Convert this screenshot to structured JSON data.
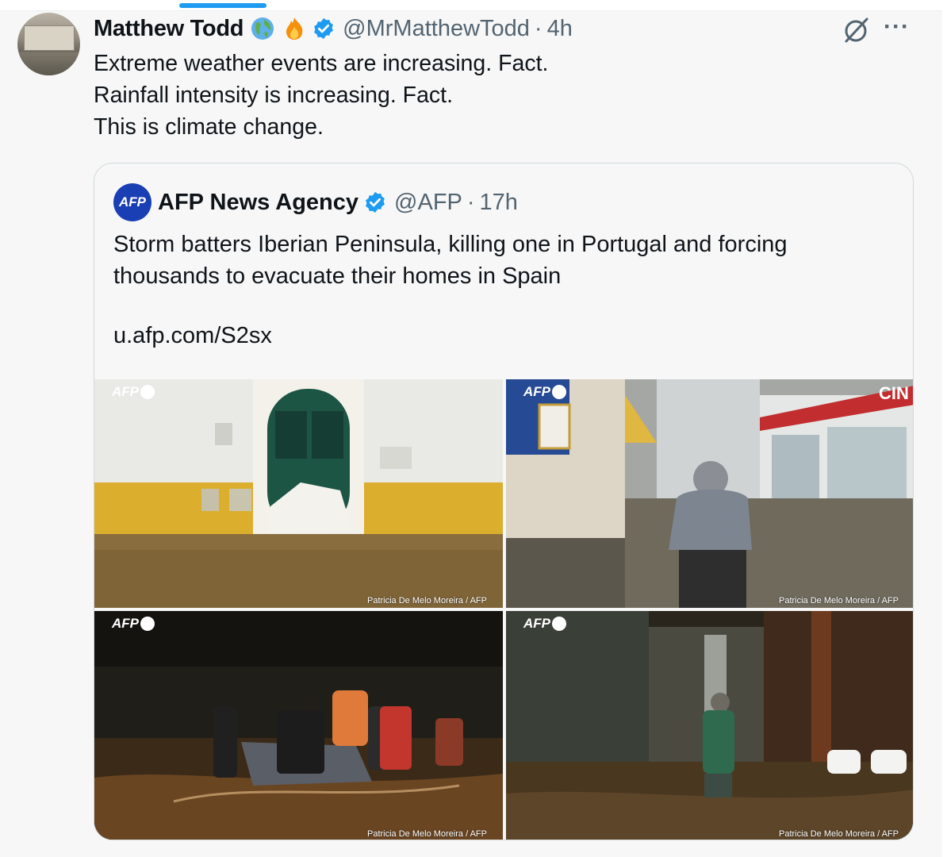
{
  "tweet": {
    "author_name": "Matthew Todd",
    "emojis": [
      "globe-emoji",
      "fire-emoji"
    ],
    "verified_icon": "verified-badge-icon",
    "handle": "@MrMatthewTodd",
    "separator": "·",
    "time": "4h",
    "lines": [
      "Extreme weather events are increasing. Fact.",
      "Rainfall intensity is increasing. Fact.",
      "This is climate change."
    ],
    "actions": {
      "grok_icon": "grok-icon",
      "more_label": "···"
    }
  },
  "quoted": {
    "logo_text": "AFP",
    "author_name": "AFP News Agency",
    "handle": "@AFP",
    "separator": "·",
    "time": "17h",
    "lines": [
      "Storm batters Iberian Peninsula, killing one in Portugal and forcing",
      "thousands to evacuate their homes in Spain"
    ],
    "link": "u.afp.com/S2sx",
    "photos": [
      {
        "watermark": "AFP",
        "credit": "Patricia De Melo Moreira / AFP"
      },
      {
        "watermark": "AFP",
        "credit": "Patricia De Melo Moreira / AFP"
      },
      {
        "watermark": "AFP",
        "credit": "Patricia De Melo Moreira / AFP"
      },
      {
        "watermark": "AFP",
        "credit": "Patricia De Melo Moreira / AFP"
      }
    ],
    "photo2_sign": "CIN"
  },
  "colors": {
    "accent": "#1d9bf0",
    "secondary_text": "#536471",
    "afp_blue": "#1a3fb4"
  }
}
